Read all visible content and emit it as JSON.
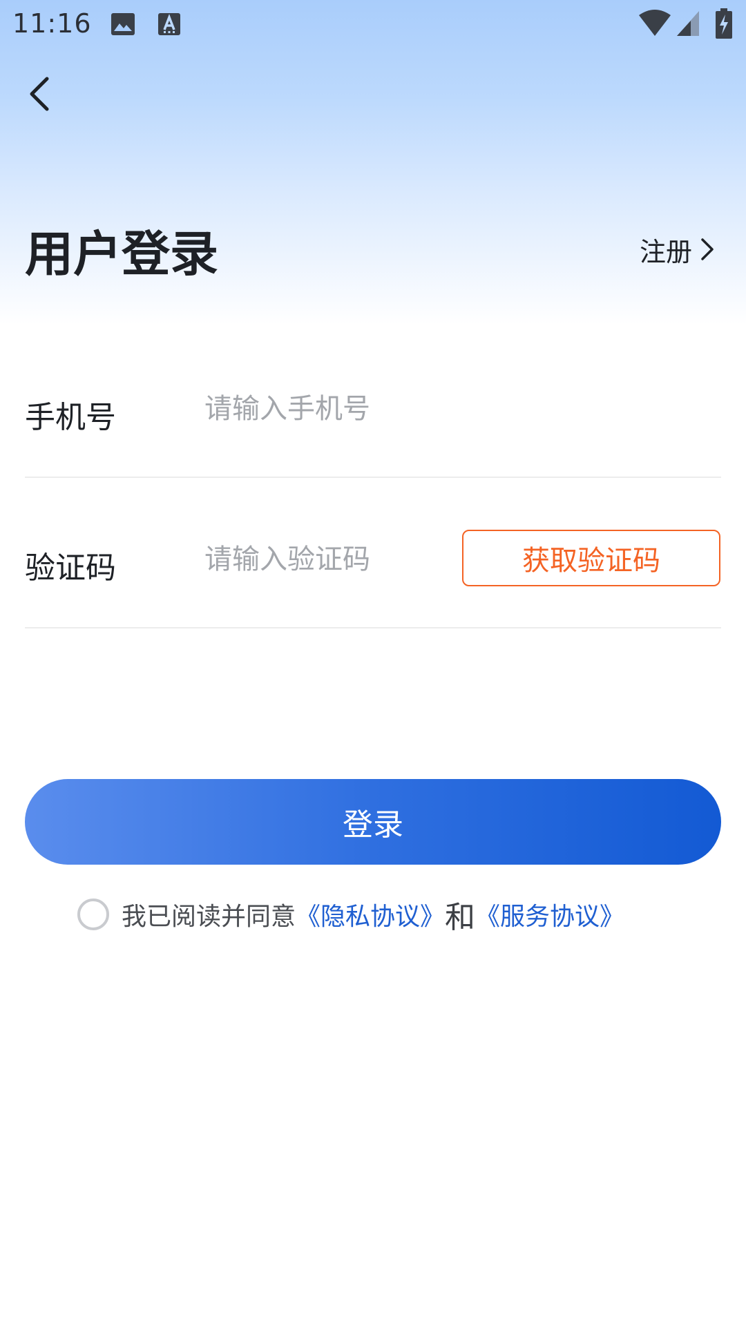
{
  "status_bar": {
    "time": "11:16",
    "icons": [
      "image-icon",
      "font-icon",
      "wifi-icon",
      "signal-icon",
      "battery-charging-icon"
    ]
  },
  "header": {
    "back_icon": "chevron-left-icon",
    "title": "用户登录",
    "register_label": "注册",
    "register_icon": "chevron-right-icon"
  },
  "form": {
    "phone": {
      "label": "手机号",
      "value": "",
      "placeholder": "请输入手机号"
    },
    "code": {
      "label": "验证码",
      "value": "",
      "placeholder": "请输入验证码",
      "get_code_label": "获取验证码"
    }
  },
  "login_button": {
    "label": "登录"
  },
  "agreement": {
    "checked": false,
    "prefix": "我已阅读并同意",
    "privacy_link": "《隐私协议》",
    "and": "和",
    "service_link": "《服务协议》"
  },
  "colors": {
    "accent": "#2f6fe0",
    "link": "#1f5fd1",
    "code_button": "#f46324",
    "header_gradient_top": "#a9cdfb"
  }
}
